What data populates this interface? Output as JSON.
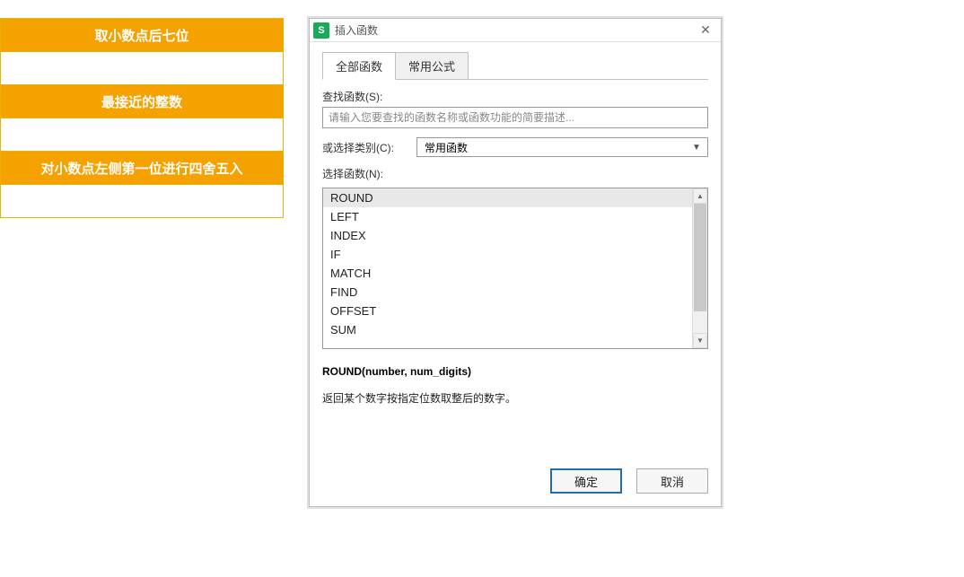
{
  "left": {
    "r1": "取小数点后七位",
    "r2": "",
    "r3": "最接近的整数",
    "r4": "",
    "r5": "对小数点左侧第一位进行四舍五入",
    "r6": ""
  },
  "dialog": {
    "title": "插入函数",
    "tabs": {
      "all": "全部函数",
      "common": "常用公式"
    },
    "search_label": "查找函数(S):",
    "search_placeholder": "请输入您要查找的函数名称或函数功能的简要描述...",
    "category_label": "或选择类别(C):",
    "category_value": "常用函数",
    "select_label": "选择函数(N):",
    "functions": [
      "ROUND",
      "LEFT",
      "INDEX",
      "IF",
      "MATCH",
      "FIND",
      "OFFSET",
      "SUM"
    ],
    "selected_function": "ROUND",
    "description": {
      "signature": "ROUND(number, num_digits)",
      "text": "返回某个数字按指定位数取整后的数字。"
    },
    "ok": "确定",
    "cancel": "取消"
  }
}
